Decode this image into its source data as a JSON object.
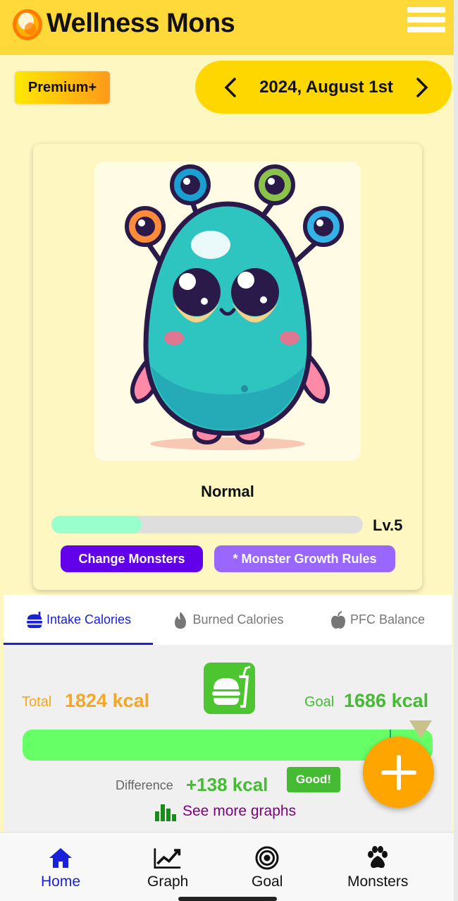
{
  "header": {
    "title": "Wellness Mons"
  },
  "plan_badge": "Premium+",
  "date_nav": {
    "date": "2024, August 1st"
  },
  "monster": {
    "status": "Normal",
    "level_label": "Lv.5",
    "level_progress": 0.29,
    "change_button": "Change Monsters",
    "rules_button": "* Monster Growth Rules"
  },
  "tabs": [
    {
      "label": "Intake Calories",
      "icon": "burger-icon",
      "active": true
    },
    {
      "label": "Burned Calories",
      "icon": "flame-icon",
      "active": false
    },
    {
      "label": "PFC Balance",
      "icon": "apple-icon",
      "active": false
    }
  ],
  "calories": {
    "total_label": "Total",
    "total_value": "1824 kcal",
    "goal_label": "Goal",
    "goal_value": "1686 kcal",
    "difference_label": "Difference",
    "difference_value": "+138 kcal",
    "rating": "Good!",
    "see_more": "See more graphs"
  },
  "bottom_nav": [
    {
      "label": "Home",
      "icon": "home-icon",
      "active": true
    },
    {
      "label": "Graph",
      "icon": "line-chart-icon",
      "active": false
    },
    {
      "label": "Goal",
      "icon": "target-icon",
      "active": false
    },
    {
      "label": "Monsters",
      "icon": "paw-icon",
      "active": false
    }
  ],
  "colors": {
    "header": "#ffd83a",
    "background": "#fff7c2",
    "accent": "#1a20d8",
    "primary_button": "#6200ea",
    "secondary_button": "#9966ff",
    "good": "#44bb33",
    "total": "#f5a623",
    "fab": "#ffa500"
  }
}
